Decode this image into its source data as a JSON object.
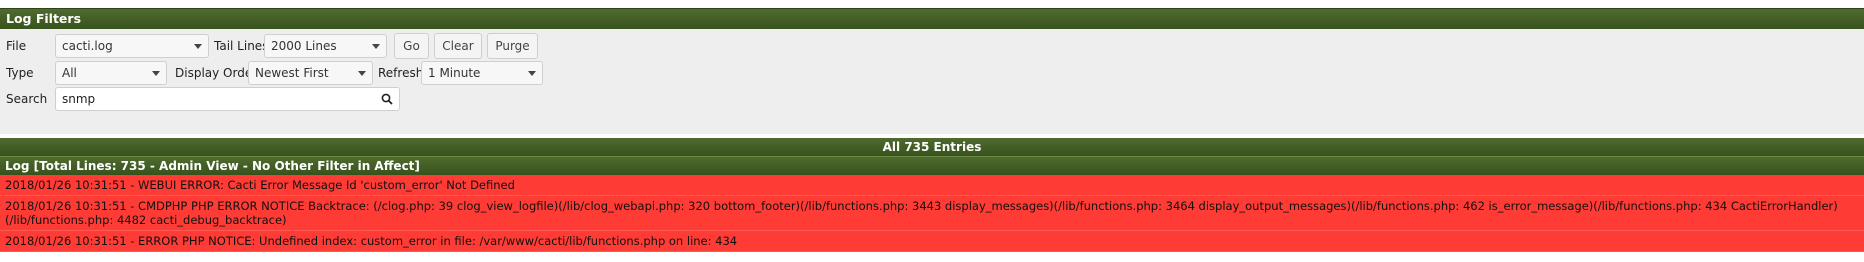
{
  "filters": {
    "title": "Log Filters",
    "file": {
      "label": "File",
      "value": "cacti.log"
    },
    "tail_lines": {
      "label": "Tail Lines",
      "value": "2000 Lines"
    },
    "buttons": {
      "go": "Go",
      "clear": "Clear",
      "purge": "Purge"
    },
    "type": {
      "label": "Type",
      "value": "All"
    },
    "display_order": {
      "label": "Display Order",
      "value": "Newest First"
    },
    "refresh": {
      "label": "Refresh",
      "value": "1 Minute"
    },
    "search": {
      "label": "Search",
      "value": "snmp"
    }
  },
  "entries_bar": "All 735 Entries",
  "log": {
    "header": "Log [Total Lines: 735 - Admin View - No Other Filter in Affect]",
    "lines": [
      "2018/01/26 10:31:51 - WEBUI ERROR: Cacti Error Message Id 'custom_error' Not Defined",
      "2018/01/26 10:31:51 - CMDPHP PHP ERROR NOTICE Backtrace: (/clog.php: 39 clog_view_logfile)(/lib/clog_webapi.php: 320 bottom_footer)(/lib/functions.php: 3443 display_messages)(/lib/functions.php: 3464 display_output_messages)(/lib/functions.php: 462 is_error_message)(/lib/functions.php: 434 CactiErrorHandler)(/lib/functions.php: 4482 cacti_debug_backtrace)",
      "2018/01/26 10:31:51 - ERROR PHP NOTICE: Undefined index: custom_error in file: /var/www/cacti/lib/functions.php on line: 434"
    ]
  },
  "colors": {
    "header_green": "#3f5a23",
    "error_red": "#ff3b35"
  }
}
